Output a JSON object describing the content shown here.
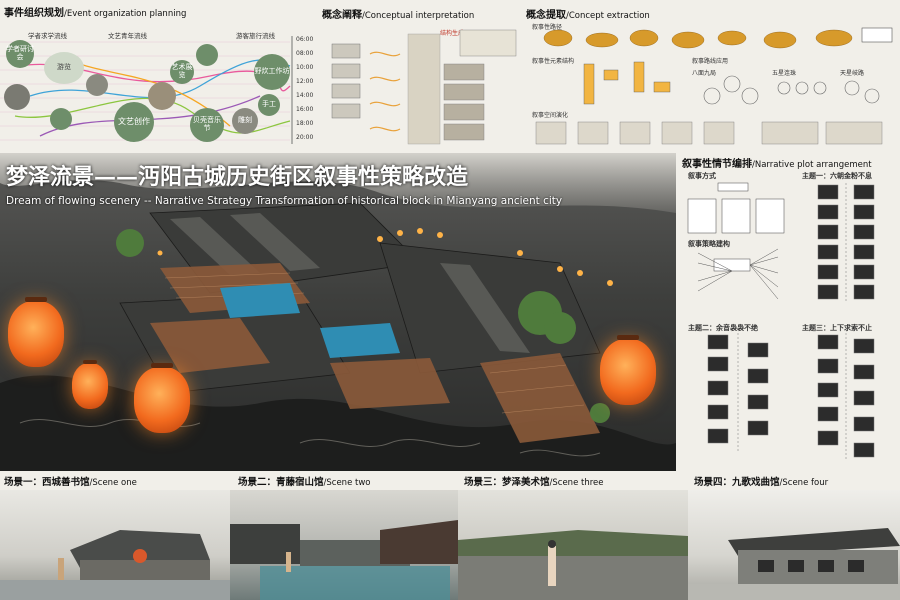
{
  "event_planning": {
    "title": "事件组织规划",
    "title_en": "/Event organization planning",
    "flows": [
      "学者求学流线",
      "文艺青年流线",
      "游客旅行流线"
    ],
    "axis_ticks": [
      "06:00",
      "08:00",
      "10:00",
      "12:00",
      "14:00",
      "16:00",
      "18:00",
      "20:00"
    ],
    "bubbles": [
      "学者研讨会",
      "游览",
      "文艺创作",
      "野炊工作坊",
      "艺术展览",
      "贝壳音乐节",
      "雕刻",
      "手工"
    ]
  },
  "concept_interpretation": {
    "title": "概念阐释",
    "title_en": "/Conceptual interpretation",
    "sub": "结构生成"
  },
  "concept_extraction": {
    "title": "概念提取",
    "title_en": "/Concept extraction",
    "labels": [
      "叙事性路径",
      "叙事性元素结构",
      "叙事路线应用",
      "八面九局",
      "叙事空间演化",
      "五星连珠",
      "天星岐路"
    ]
  },
  "hero": {
    "title_cn": "梦泽流景——沔阳古城历史街区叙事性策略改造",
    "title_en": "Dream of flowing scenery -- Narrative Strategy Transformation of historical block in Mianyang ancient city"
  },
  "plot": {
    "title": "叙事性情节编排",
    "title_en": "/Narrative plot arrangement",
    "sections": [
      "叙事方式",
      "叙事策略建构"
    ],
    "themes": [
      "主题一：六朝金粉不息",
      "主题二：余音袅袅不绝",
      "主题三：上下求索不止"
    ]
  },
  "scenes": [
    {
      "cn": "场景一：西城善书馆",
      "en": "/Scene one"
    },
    {
      "cn": "场景二：青藤宿山馆",
      "en": "/Scene two"
    },
    {
      "cn": "场景三：梦泽美术馆",
      "en": "/Scene three"
    },
    {
      "cn": "场景四：九歌戏曲馆",
      "en": "/Scene four"
    }
  ],
  "colors": {
    "accent_orange": "#f26a1e",
    "bubble_green": "#6e8e6a",
    "bubble_grey": "#8a8a80"
  }
}
